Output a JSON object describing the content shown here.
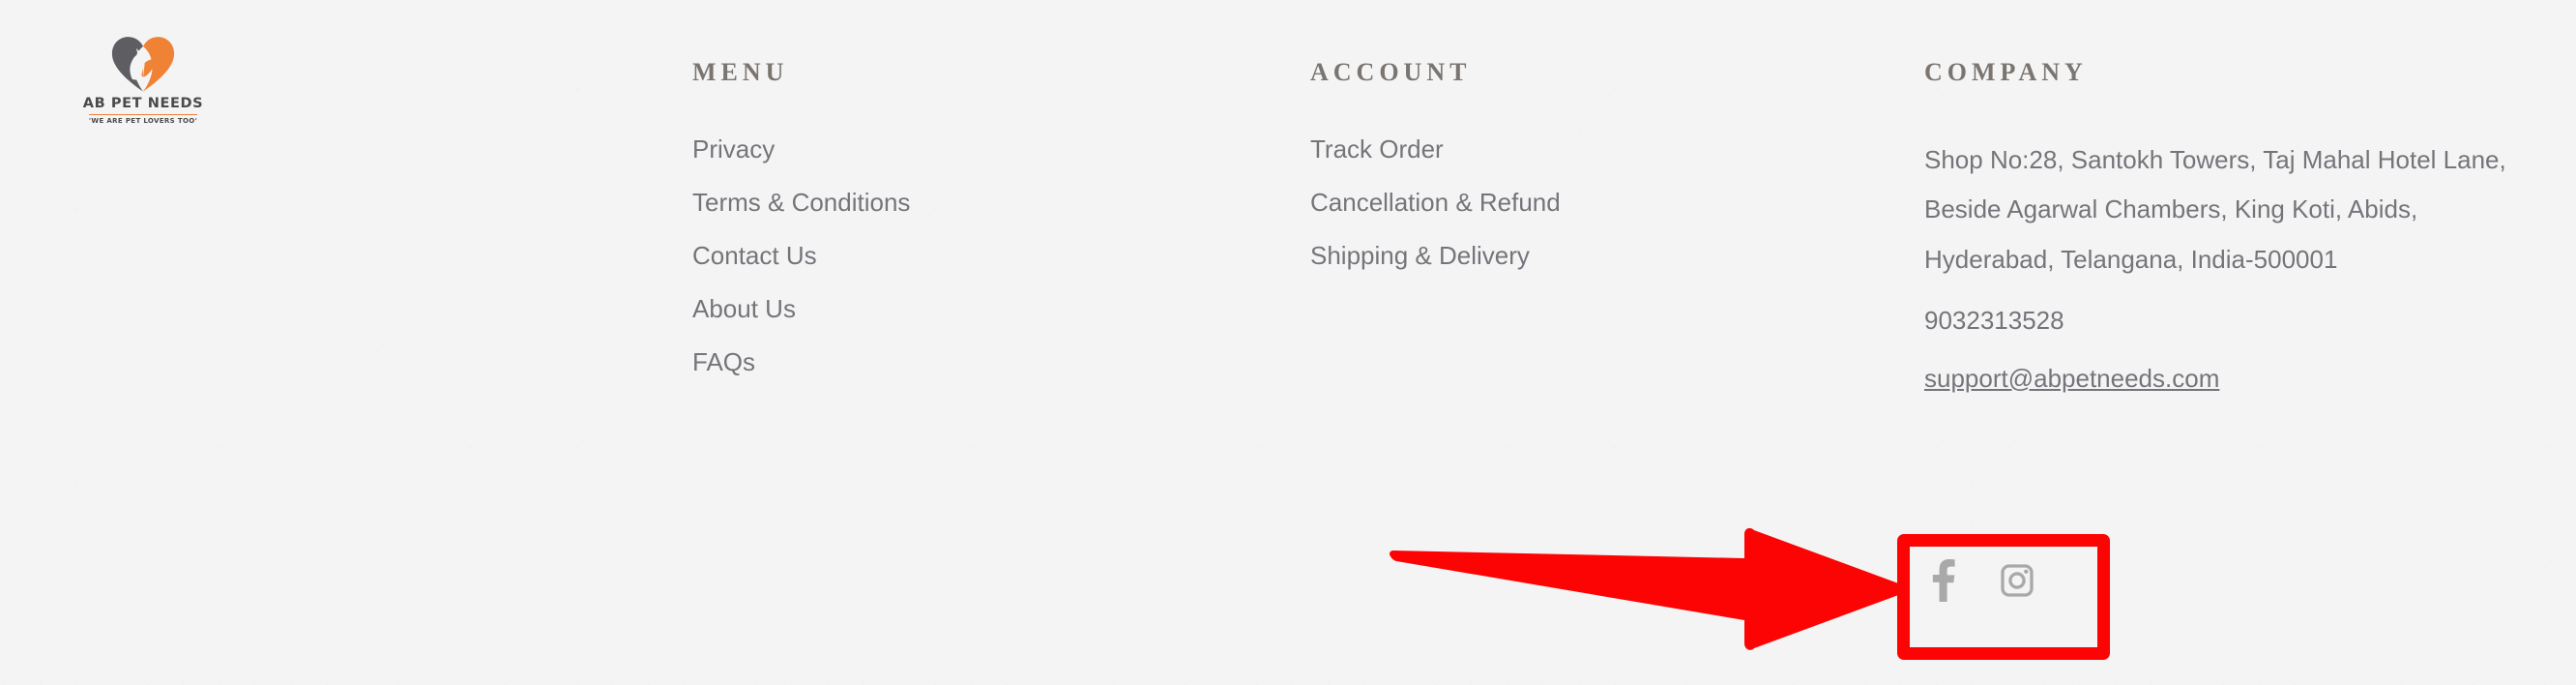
{
  "brand": {
    "logo_icon": "pet-heart-logo-icon",
    "name": "AB PET NEEDS",
    "tagline": "'WE ARE PET LOVERS TOO'",
    "colors": {
      "orange": "#e8833a",
      "gray": "#5b5b5b"
    }
  },
  "columns": {
    "menu": {
      "title": "MENU",
      "items": [
        {
          "label": "Privacy"
        },
        {
          "label": "Terms & Conditions"
        },
        {
          "label": "Contact Us"
        },
        {
          "label": "About Us"
        },
        {
          "label": "FAQs"
        }
      ]
    },
    "account": {
      "title": "ACCOUNT",
      "items": [
        {
          "label": "Track Order"
        },
        {
          "label": "Cancellation & Refund"
        },
        {
          "label": "Shipping & Delivery"
        }
      ]
    },
    "company": {
      "title": "COMPANY",
      "address": "Shop No:28, Santokh Towers, Taj Mahal Hotel Lane, Beside Agarwal Chambers, King Koti, Abids, Hyderabad, Telangana, India-500001",
      "phone": "9032313528",
      "email": "support@abpetneeds.com"
    }
  },
  "social": [
    {
      "name": "facebook",
      "icon": "facebook-icon"
    },
    {
      "name": "instagram",
      "icon": "instagram-icon"
    }
  ],
  "annotations": {
    "highlight_color": "#fc0404",
    "arrow": "red-arrow-pointing-right",
    "box": "red-highlight-box-around-social-icons"
  },
  "theme": {
    "background": "#f4f4f4",
    "text_gray": "#76747a",
    "heading_gray": "#7a7571",
    "icon_gray": "#a9a9a9"
  }
}
